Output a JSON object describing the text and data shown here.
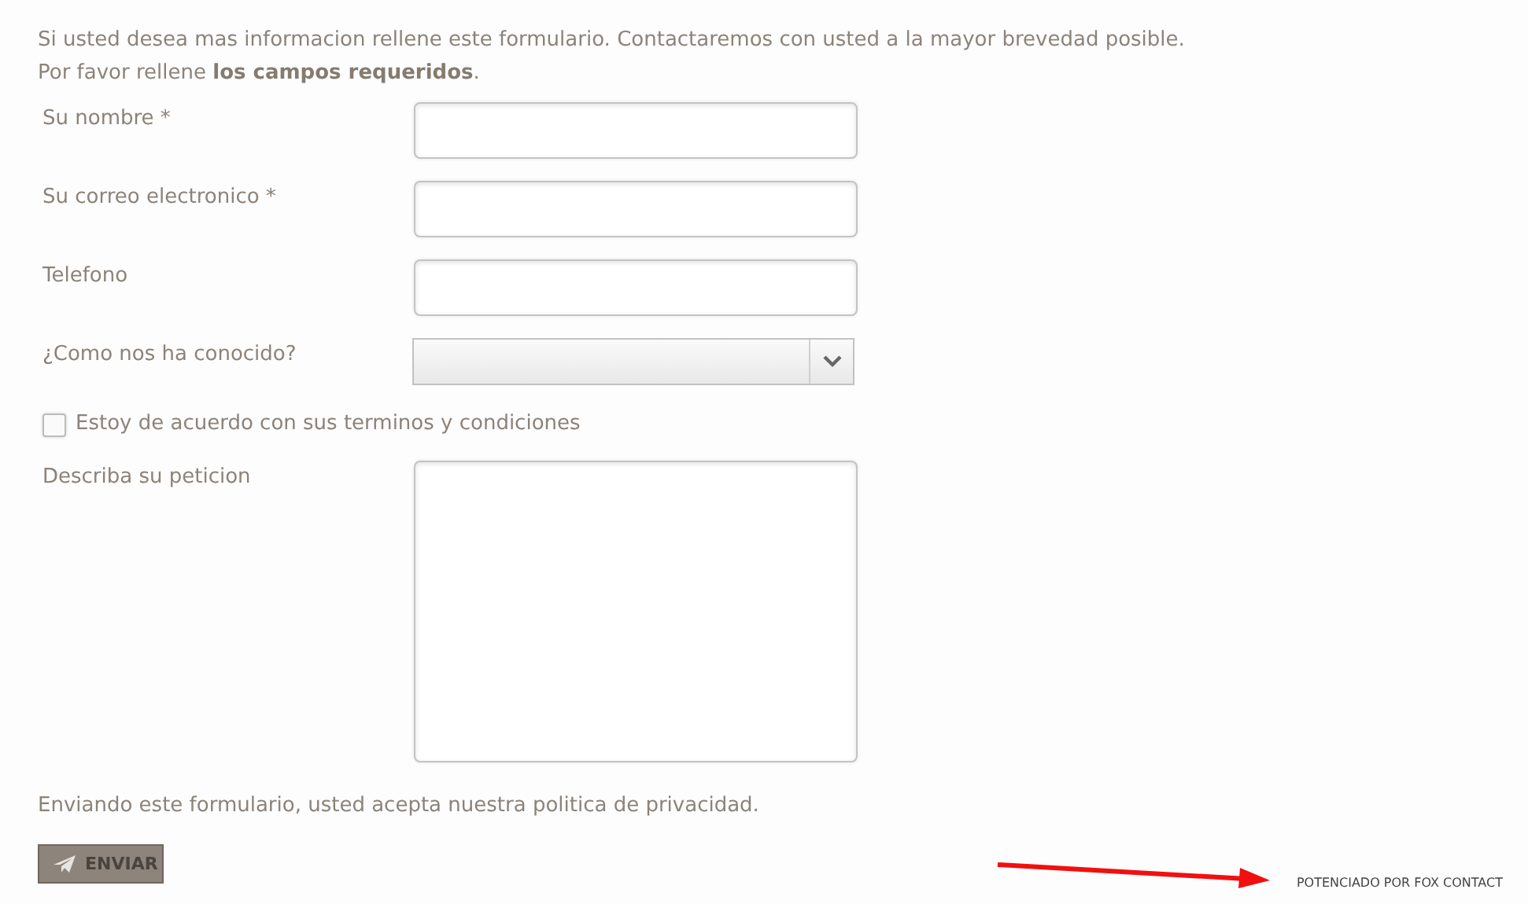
{
  "intro": [
    "Si usted desea mas informacion rellene este formulario. Contactaremos con usted a la mayor brevedad posible.",
    "Por favor rellene **los campos requeridos**."
  ],
  "fields": [
    {
      "kind": "text",
      "label": "Su nombre *"
    },
    {
      "kind": "text",
      "label": "Su correo electronico *"
    },
    {
      "kind": "text",
      "label": "Telefono"
    },
    {
      "kind": "select",
      "label": "¿Como nos ha conocido?"
    },
    {
      "kind": "checkbox",
      "label": "Estoy de acuerdo con sus terminos y condiciones",
      "checked": false
    },
    {
      "kind": "textarea",
      "label": "Describa su peticion"
    }
  ],
  "privacy_note": "Enviando este formulario, usted acepta nuestra politica de privacidad.",
  "submit_button": "ENVIAR",
  "powered_by": "POTENCIADO POR FOX CONTACT"
}
